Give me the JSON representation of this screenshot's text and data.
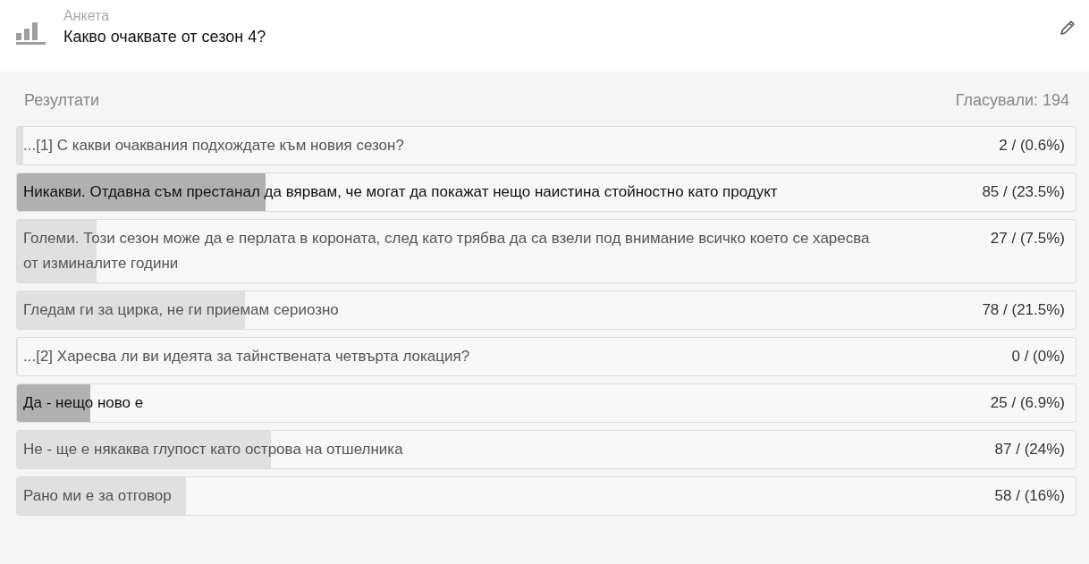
{
  "header": {
    "label": "Анкета",
    "title": "Какво очаквате от сезон 4?"
  },
  "results": {
    "title": "Резултати",
    "votes": "Гласували: 194"
  },
  "options": [
    {
      "text": "...[1] С какви очаквания подхождате към новия сезон?",
      "count": "2 / (0.6%)",
      "level": 0.006,
      "selected": false
    },
    {
      "text": "Никакви. Отдавна съм престанал да вярвам, че могат да покажат нещо наистина стойностно като продукт",
      "count": "85 / (23.5%)",
      "level": 0.235,
      "selected": true
    },
    {
      "text": "Големи. Този сезон може да е перлата в короната, след като трябва да са взели под внимание всичко което се харесва от изминалите години",
      "count": "27 / (7.5%)",
      "level": 0.075,
      "selected": false
    },
    {
      "text": "Гледам ги за цирка, не ги приемам сериозно",
      "count": "78 / (21.5%)",
      "level": 0.215,
      "selected": false
    },
    {
      "text": "...[2] Харесва ли ви идеята за тайнствената четвърта локация?",
      "count": "0 / (0%)",
      "level": 0,
      "selected": false
    },
    {
      "text": "Да - нещо ново е",
      "count": "25 / (6.9%)",
      "level": 0.069,
      "selected": true
    },
    {
      "text": "Не - ще е някаква глупост като острова на отшелника",
      "count": "87 / (24%)",
      "level": 0.24,
      "selected": false
    },
    {
      "text": "Рано ми е за отговор",
      "count": "58 / (16%)",
      "level": 0.16,
      "selected": false
    }
  ]
}
